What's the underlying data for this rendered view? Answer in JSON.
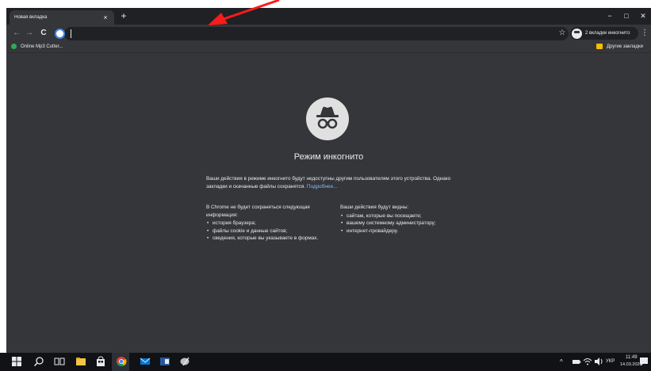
{
  "window": {
    "tab_title": "Новая вкладка",
    "tab_close": "×",
    "new_tab": "+",
    "minimize": "−",
    "maximize": "□",
    "close": "✕"
  },
  "toolbar": {
    "back": "←",
    "forward": "→",
    "reload": "C",
    "omnibox_value": "",
    "star": "☆",
    "incognito_chip": "2 вкладки инкогнито",
    "menu": "⋮"
  },
  "bookmarks": {
    "items": [
      {
        "label": "Online Mp3 Cutter..."
      }
    ],
    "other": "Другие закладки"
  },
  "incognito_page": {
    "title": "Режим инкогнито",
    "intro": "Ваши действия в режиме инкогнито будут недоступны другим пользователям этого устройства. Однако закладки и скачанные файлы сохранятся.",
    "learn_more": "Подробнее...",
    "not_saved_heading": "В Chrome не будет сохраняться следующая информация:",
    "not_saved": [
      "история браузера;",
      "файлы cookie и данные сайтов;",
      "сведения, которые вы указываете в формах."
    ],
    "visible_heading": "Ваши действия будут видны:",
    "visible": [
      "сайтам, которые вы посещаете;",
      "вашему системному администратору;",
      "интернет-провайдеру."
    ]
  },
  "taskbar": {
    "language": "УКР",
    "time": "11:49",
    "date": "14.03.2020"
  },
  "colors": {
    "window_bg": "#35363a",
    "tabstrip_bg": "#202124",
    "link": "#8ab4f8",
    "arrow": "#ff1a1a"
  }
}
